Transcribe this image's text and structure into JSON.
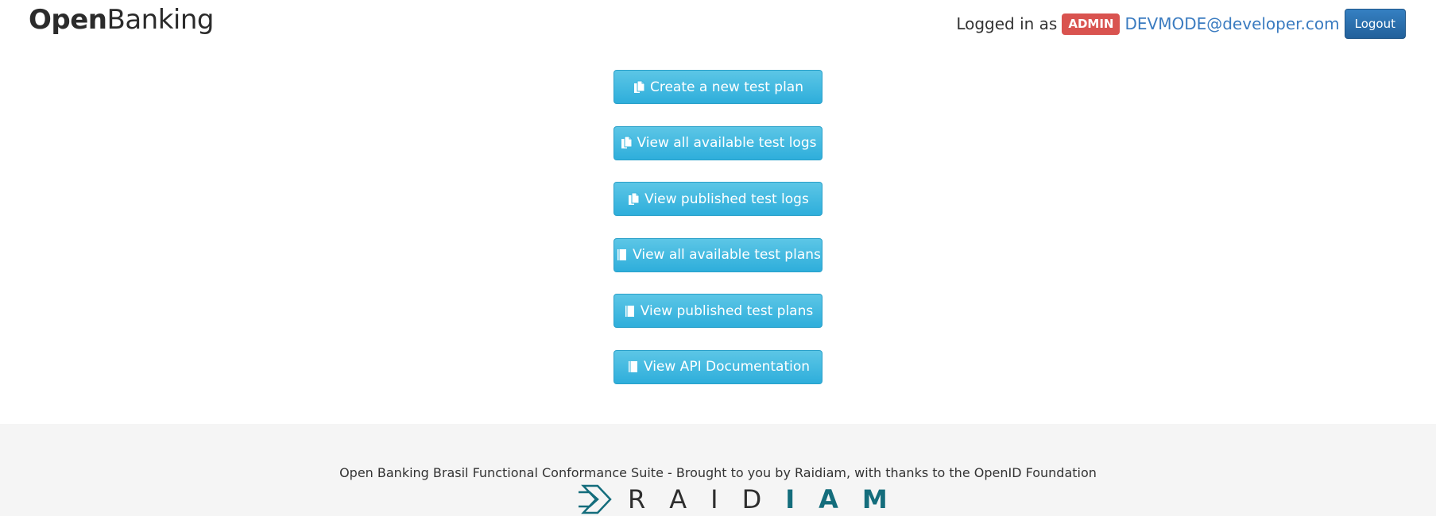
{
  "header": {
    "logo": {
      "bold": "Open",
      "light": "Banking"
    },
    "logged_in_label": "Logged in as",
    "role_badge": "ADMIN",
    "user_email": "DEVMODE@developer.com",
    "logout_label": "Logout"
  },
  "actions": [
    {
      "label": "Create a new test plan",
      "icon": "files-icon"
    },
    {
      "label": "View all available test logs",
      "icon": "files-icon"
    },
    {
      "label": "View published test logs",
      "icon": "files-icon"
    },
    {
      "label": "View all available test plans",
      "icon": "book-icon"
    },
    {
      "label": "View published test plans",
      "icon": "book-icon"
    },
    {
      "label": "View API Documentation",
      "icon": "book-icon"
    }
  ],
  "footer": {
    "credit": "Open Banking Brasil Functional Conformance Suite - Brought to you by Raidiam, with thanks to the OpenID Foundation",
    "brand_letters": [
      "R",
      "A",
      "I",
      "D",
      "I",
      "A",
      "M"
    ]
  },
  "colors": {
    "primary_button": "#2eaedb",
    "logout_button": "#2a6ea8",
    "admin_badge": "#d9534f",
    "email_link": "#3a7bc0",
    "brand_teal": "#146d7c",
    "footer_bg": "#f5f5f5"
  }
}
